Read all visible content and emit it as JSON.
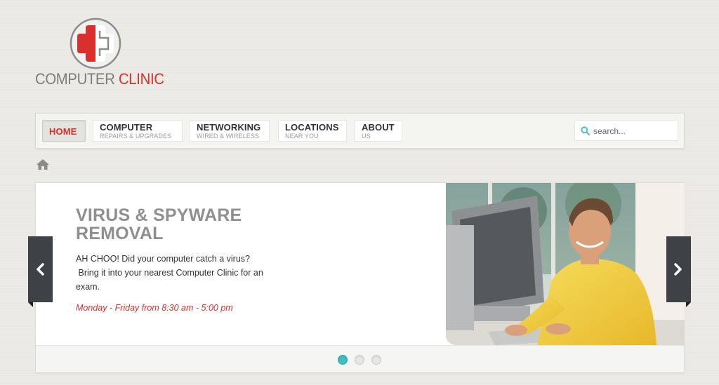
{
  "brand": {
    "name_part1": "COMPUTER",
    "name_part2": "CLINIC",
    "accent_color": "#d8302c",
    "logo_icon": "medical-cross-icon"
  },
  "nav": {
    "items": [
      {
        "title": "HOME",
        "subtitle": "",
        "active": true
      },
      {
        "title": "COMPUTER",
        "subtitle": "REPAIRS & UPGRADES",
        "active": false
      },
      {
        "title": "NETWORKING",
        "subtitle": "WIRED & WIRELESS",
        "active": false
      },
      {
        "title": "LOCATIONS",
        "subtitle": "NEAR YOU",
        "active": false
      },
      {
        "title": "ABOUT",
        "subtitle": "US",
        "active": false
      }
    ],
    "search": {
      "placeholder": "search...",
      "value": "",
      "icon": "search-icon",
      "icon_color": "#3fbfc4"
    }
  },
  "breadcrumb": {
    "icon": "home-icon"
  },
  "slider": {
    "title": "VIRUS & SPYWARE REMOVAL",
    "body_line1": "AH CHOO! Did your computer catch a virus?",
    "body_line2": "Bring it into your nearest Computer Clinic for an exam.",
    "hours": "Monday - Friday from 8:30 am - 5:00 pm",
    "image": "man-at-computer-photo",
    "prev_icon": "chevron-left-icon",
    "next_icon": "chevron-right-icon",
    "slide_count": 3,
    "current_slide": 1,
    "active_dot_color": "#3fbfc4"
  }
}
